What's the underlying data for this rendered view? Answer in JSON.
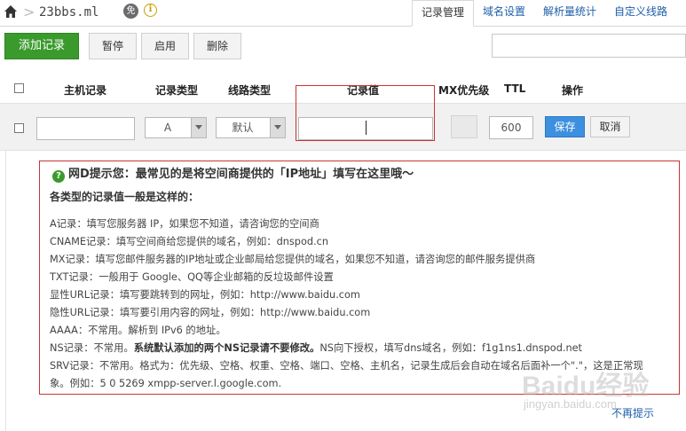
{
  "breadcrumb": {
    "separator": ">",
    "domain": "23bbs.ml",
    "badge": "免",
    "info": "i"
  },
  "tabs": [
    {
      "label": "记录管理",
      "active": true
    },
    {
      "label": "域名设置"
    },
    {
      "label": "解析量统计"
    },
    {
      "label": "自定义线路"
    }
  ],
  "toolbar": {
    "add": "添加记录",
    "pause": "暂停",
    "enable": "启用",
    "delete": "删除"
  },
  "table": {
    "headers": {
      "host": "主机记录",
      "type": "记录类型",
      "line": "线路类型",
      "value": "记录值",
      "mx": "MX优先级",
      "ttl": "TTL",
      "ops": "操作"
    },
    "edit": {
      "type": "A",
      "line": "默认",
      "ttl": "600",
      "save": "保存",
      "cancel": "取消"
    }
  },
  "tip": {
    "icon": "?",
    "title": "网D提示您：最常见的是将空间商提供的「IP地址」填写在这里哦～",
    "subtitle": "各类型的记录值一般是这样的：",
    "lines": {
      "a": "A记录：填写您服务器 IP，如果您不知道，请咨询您的空间商",
      "cname": "CNAME记录：填写空间商给您提供的域名，例如：dnspod.cn",
      "mx": "MX记录：填写您邮件服务器的IP地址或企业邮局给您提供的域名，如果您不知道，请咨询您的邮件服务提供商",
      "txt": "TXT记录：一般用于 Google、QQ等企业邮箱的反垃圾邮件设置",
      "url": "显性URL记录：填写要跳转到的网址，例如：http://www.baidu.com",
      "hidden_url": "隐性URL记录：填写要引用内容的网址，例如：http://www.baidu.com",
      "aaaa": "AAAA：不常用。解析到 IPv6 的地址。",
      "ns_pre": "NS记录：不常用。",
      "ns_bold": "系统默认添加的两个NS记录请不要修改。",
      "ns_post": "NS向下授权，填写dns域名，例如：f1g1ns1.dnspod.net",
      "srv": "SRV记录：不常用。格式为：优先级、空格、权重、空格、端口、空格、主机名，记录生成后会自动在域名后面补一个\".\"，这是正常现",
      "srv_2": "象。例如：5 0 5269 xmpp-server.l.google.com."
    },
    "dismiss": "不再提示"
  },
  "watermark": {
    "main": "Baidu经验",
    "sub": "jingyan.baidu.com"
  },
  "colors": {
    "accent_green": "#3a9a2c",
    "save_blue": "#3d8fe0",
    "highlight_red": "#cc3333",
    "link_blue": "#1f5fa8"
  }
}
